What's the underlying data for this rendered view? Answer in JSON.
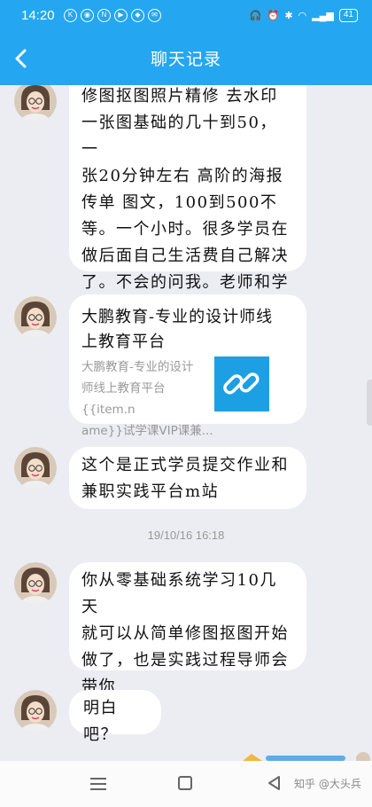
{
  "status_bar": {
    "time": "14:20",
    "battery": "41"
  },
  "header": {
    "title": "聊天记录"
  },
  "messages": [
    {
      "text": "修图抠图照片精修 去水印\n一张图基础的几十到50，一\n张20分钟左右 高阶的海报\n传单 图文，100到500不\n等。一个小时。很多学员在\n做后面自己生活费自己解决\n了。不会的问我。老师和学\n管可以把关，"
    },
    {
      "title": "大鹏教育-专业的设计师线\n上教育平台",
      "desc": "大鹏教育-专业的设计\n师线上教育平台{{item.n\name}}试学课VIP课兼..."
    },
    {
      "text": "这个是正式学员提交作业和\n兼职实践平台m站"
    },
    {
      "text": "你从零基础系统学习10几天\n就可以从简单修图抠图开始\n做了，也是实践过程导师会\n带你"
    },
    {
      "text": "明白吧？"
    }
  ],
  "timestamp": "19/10/16 16:18",
  "watermark": "知乎 @大头兵",
  "colors": {
    "primary": "#24a7f0",
    "bubble": "#ffffff",
    "background": "#ececf3"
  },
  "icons": [
    "back-arrow-icon",
    "link-icon",
    "menu-icon",
    "home-icon",
    "back-triangle-icon"
  ]
}
